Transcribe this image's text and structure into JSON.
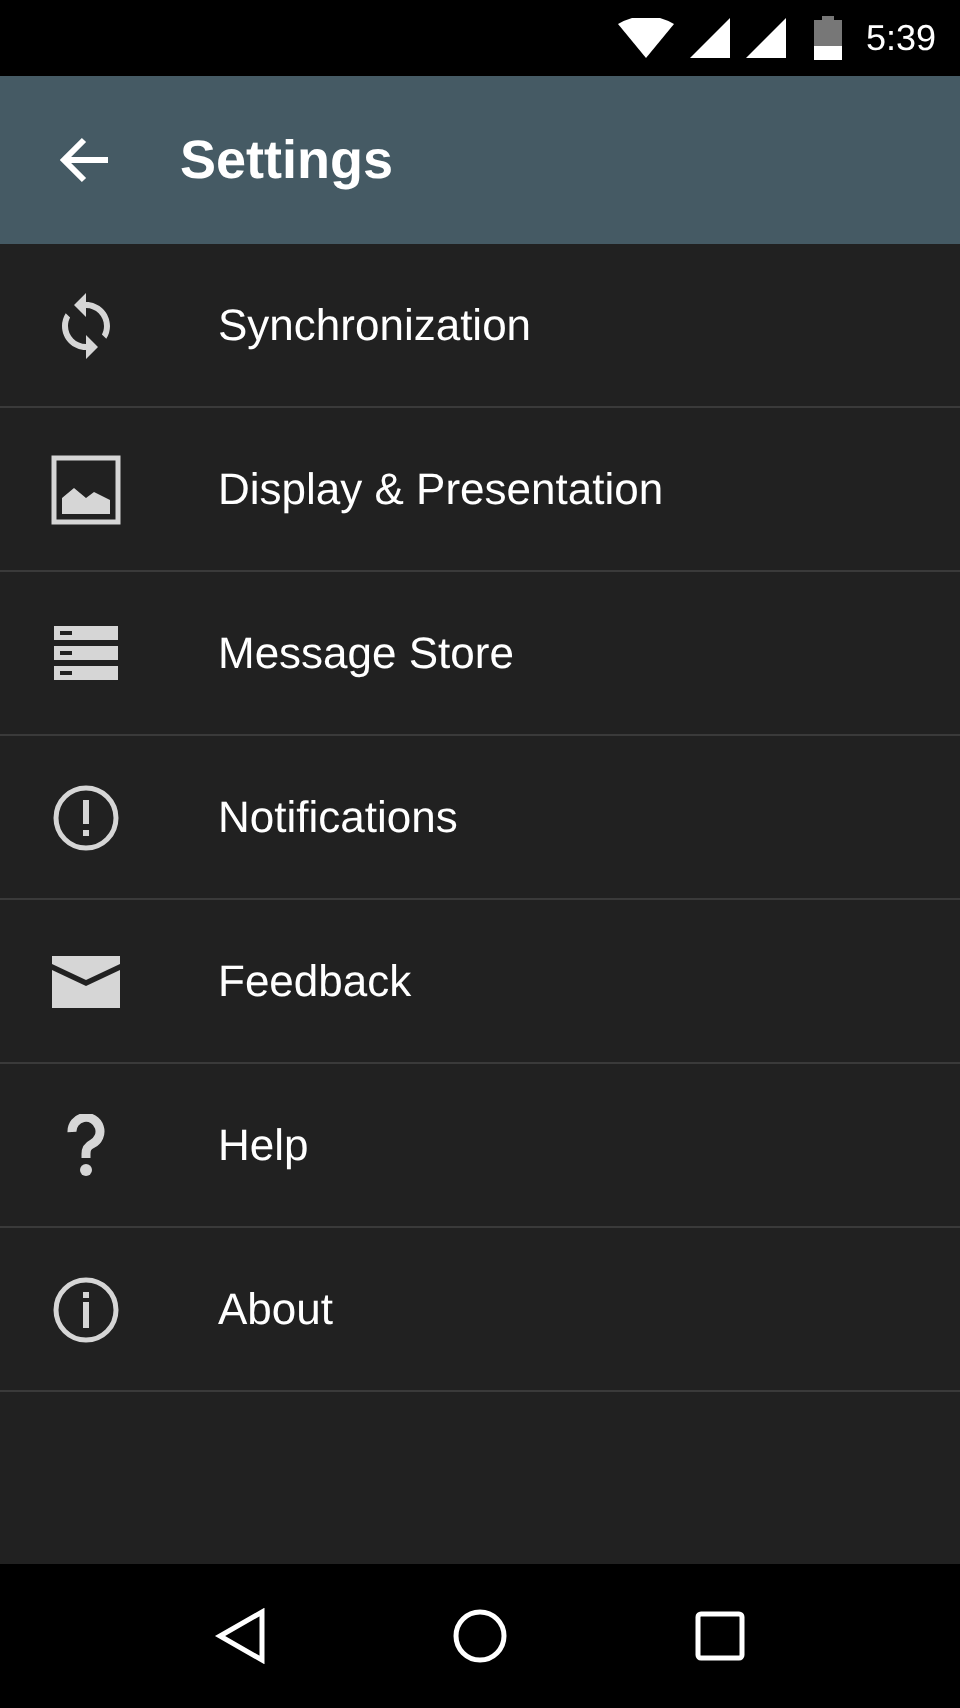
{
  "status_bar": {
    "time": "5:39"
  },
  "toolbar": {
    "title": "Settings"
  },
  "items": [
    {
      "label": "Synchronization"
    },
    {
      "label": "Display & Presentation"
    },
    {
      "label": "Message Store"
    },
    {
      "label": "Notifications"
    },
    {
      "label": "Feedback"
    },
    {
      "label": "Help"
    },
    {
      "label": "About"
    }
  ]
}
